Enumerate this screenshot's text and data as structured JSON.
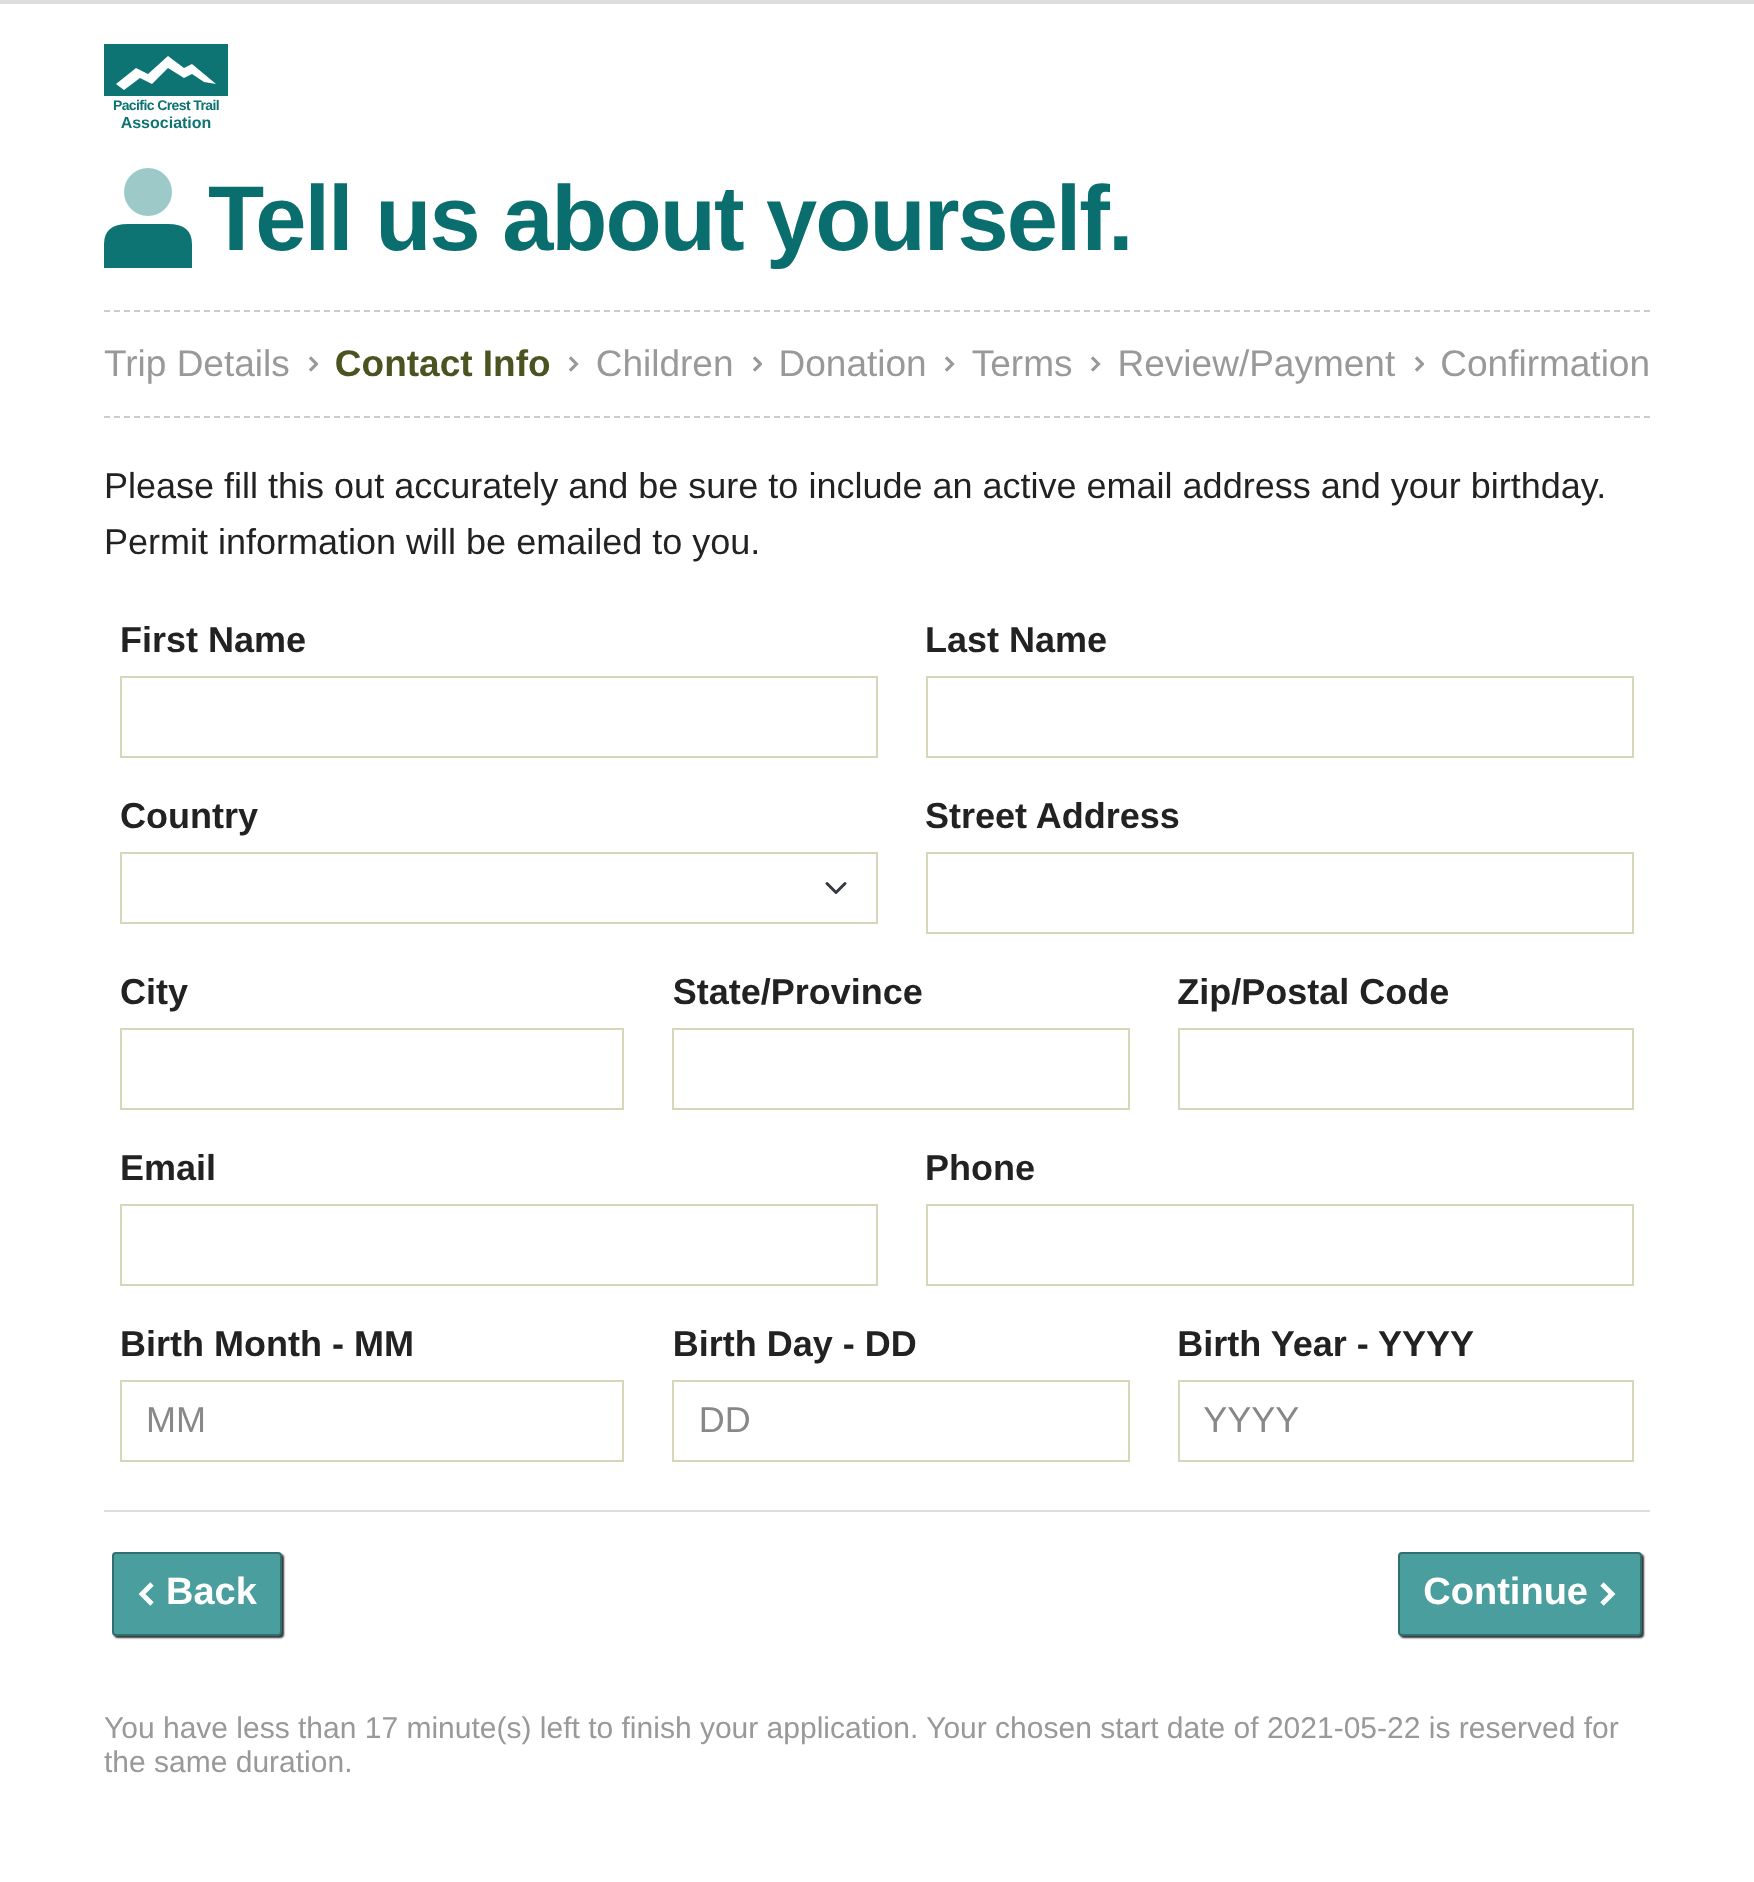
{
  "logo": {
    "line_1": "Pacific Crest Trail",
    "line_2": "Association"
  },
  "title": "Tell us about yourself.",
  "steps": [
    {
      "label": "Trip Details",
      "selected": false
    },
    {
      "label": "Contact Info",
      "selected": true
    },
    {
      "label": "Children",
      "selected": false
    },
    {
      "label": "Donation",
      "selected": false
    },
    {
      "label": "Terms",
      "selected": false
    },
    {
      "label": "Review/Payment",
      "selected": false
    },
    {
      "label": "Confirmation",
      "selected": false
    }
  ],
  "intro": "Please fill this out accurately and be sure to include an active email address and your birthday. Permit information will be emailed to you.",
  "form_rows": [
    {
      "fields": [
        {
          "label": "First Name",
          "kind": "text"
        },
        {
          "label": "Last Name",
          "kind": "text"
        }
      ]
    },
    {
      "fields": [
        {
          "label": "Country",
          "kind": "select"
        },
        {
          "label": "Street Address",
          "kind": "text"
        }
      ]
    },
    {
      "fields": [
        {
          "label": "City",
          "kind": "text"
        },
        {
          "label": "State/Province",
          "kind": "text"
        },
        {
          "label": "Zip/Postal Code",
          "kind": "text"
        }
      ]
    },
    {
      "fields": [
        {
          "label": "Email",
          "kind": "text"
        },
        {
          "label": "Phone",
          "kind": "text"
        }
      ]
    },
    {
      "fields": [
        {
          "label": "Birth Month - MM",
          "kind": "text",
          "placeholder": "MM"
        },
        {
          "label": "Birth Day - DD",
          "kind": "text",
          "placeholder": "DD"
        },
        {
          "label": "Birth Year - YYYY",
          "kind": "text",
          "placeholder": "YYYY"
        }
      ]
    }
  ],
  "buttons": {
    "back": "Back",
    "continue": "Continue"
  },
  "notice": "You have less than 17 minute(s) left to finish your application. Your chosen start date of 2021-05-22 is reserved for the same duration."
}
